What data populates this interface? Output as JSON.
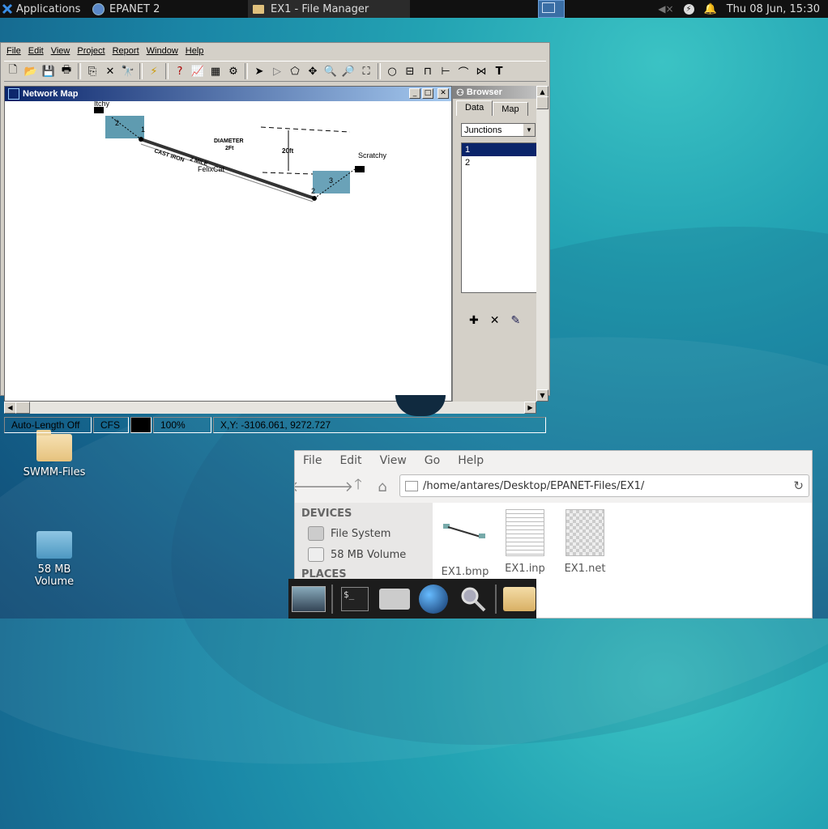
{
  "panel": {
    "applications_label": "Applications",
    "task_epanet": "EPANET 2",
    "task_filemanager": "EX1 - File Manager",
    "clock": "Thu 08 Jun, 15:30"
  },
  "epanet": {
    "menu": [
      "File",
      "Edit",
      "View",
      "Project",
      "Report",
      "Window",
      "Help"
    ],
    "map_title": "Network Map",
    "map_labels": {
      "tank1": "Itchy",
      "tank2": "Scratchy",
      "pipe": "FelixCat",
      "node1": "1",
      "node2": "2",
      "node3": "3",
      "res2": "2",
      "diameter": "DIAMETER",
      "diameter_val": "2Ft",
      "height": "20ft",
      "material": "CAST IRON",
      "length": "2 MILE"
    },
    "browser": {
      "title": "Browser",
      "tabs": [
        "Data",
        "Map"
      ],
      "category": "Junctions",
      "items": [
        "1",
        "2"
      ],
      "selected_index": 0
    },
    "status": {
      "autolength": "Auto-Length Off",
      "units": "CFS",
      "zoom": "100%",
      "coords": "X,Y: -3106.061, 9272.727"
    }
  },
  "desktop": {
    "icons": [
      {
        "label": "SWMM-Files",
        "type": "folder"
      },
      {
        "label_line1": "58 MB",
        "label_line2": "Volume",
        "type": "drive"
      }
    ]
  },
  "filemanager": {
    "menu": [
      "File",
      "Edit",
      "View",
      "Go",
      "Help"
    ],
    "path": "/home/antares/Desktop/EPANET-Files/EX1/",
    "sections": {
      "devices": "DEVICES",
      "places": "PLACES"
    },
    "devices": [
      "File System",
      "58 MB Volume"
    ],
    "files": [
      "EX1.bmp",
      "EX1.inp",
      "EX1.net"
    ]
  }
}
